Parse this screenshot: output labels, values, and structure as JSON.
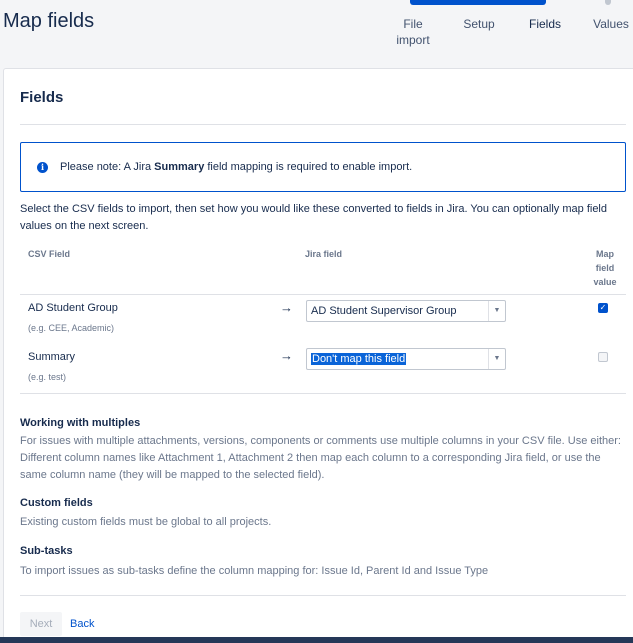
{
  "header": {
    "title": "Map fields",
    "steps": [
      {
        "label_line1": "File",
        "label_line2": "import"
      },
      {
        "label_line1": "Setup"
      },
      {
        "label_line1": "Fields"
      },
      {
        "label_line1": "Values"
      }
    ]
  },
  "card": {
    "title": "Fields",
    "notice": {
      "prefix": "Please note: A Jira ",
      "bold": "Summary",
      "suffix": " field mapping is required to enable import."
    },
    "description": "Select the CSV fields to import, then set how you would like these converted to fields in Jira. You can optionally map field values on the next screen.",
    "columns": {
      "csv": "CSV Field",
      "jira": "Jira field",
      "map_line1": "Map",
      "map_line2": "field",
      "map_line3": "value"
    },
    "rows": [
      {
        "csv": "AD Student Group",
        "example": "(e.g. CEE, Academic)",
        "arrow": "→",
        "jira": "AD Student Supervisor Group",
        "map": true
      },
      {
        "csv": "Summary",
        "example": "(e.g. test)",
        "arrow": "→",
        "jira": "Don't map this field",
        "map": false
      }
    ],
    "help": [
      {
        "title": "Working with multiples",
        "text": "For issues with multiple attachments, versions, components or comments use multiple columns in your CSV file. Use either: Different column names like Attachment 1, Attachment 2 then map each column to a corresponding Jira field, or use the same column name (they will be mapped to the selected field)."
      },
      {
        "title": "Custom fields",
        "text": "Existing custom fields must be global to all projects."
      },
      {
        "title": "Sub-tasks",
        "text": "To import issues as sub-tasks define the column mapping for: Issue Id, Parent Id and Issue Type"
      }
    ],
    "buttons": {
      "next": "Next",
      "back": "Back"
    }
  },
  "colors": {
    "accent": "#0052cc",
    "text": "#172b4d",
    "muted": "#6b778c"
  }
}
